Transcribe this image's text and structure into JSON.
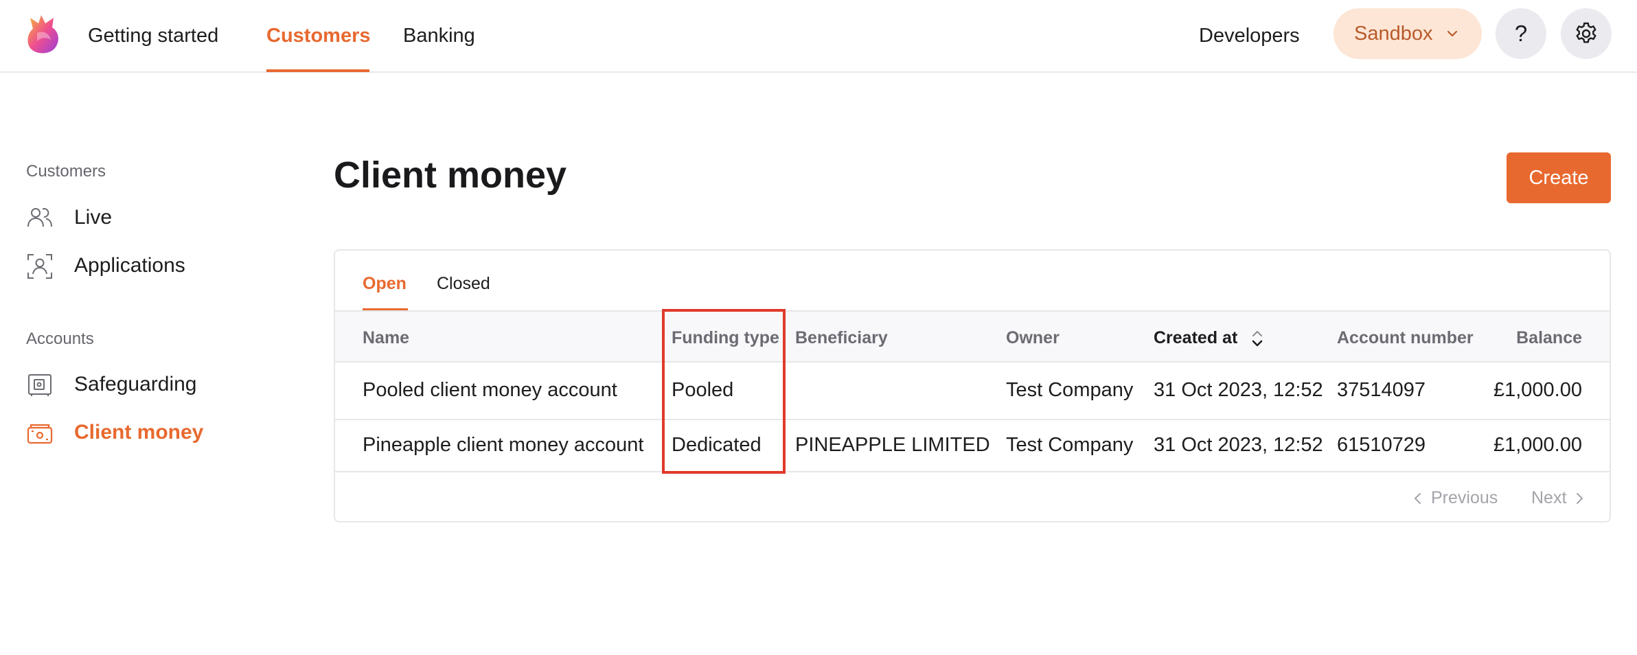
{
  "nav": {
    "items": [
      "Getting started",
      "Customers",
      "Banking"
    ],
    "active": "Customers",
    "developers": "Developers",
    "environment": "Sandbox",
    "help": "?"
  },
  "sidebar": {
    "sections": [
      {
        "heading": "Customers",
        "items": [
          {
            "label": "Live",
            "icon": "people-icon"
          },
          {
            "label": "Applications",
            "icon": "user-scan-icon"
          }
        ]
      },
      {
        "heading": "Accounts",
        "items": [
          {
            "label": "Safeguarding",
            "icon": "safe-icon"
          },
          {
            "label": "Client money",
            "icon": "wallet-icon",
            "active": true
          }
        ]
      }
    ]
  },
  "main": {
    "title": "Client money",
    "create_label": "Create",
    "tabs": [
      "Open",
      "Closed"
    ],
    "active_tab": "Open",
    "columns": [
      "Name",
      "Funding type",
      "Beneficiary",
      "Owner",
      "Created at",
      "Account number",
      "Balance"
    ],
    "sorted_column": "Created at",
    "rows": [
      {
        "name": "Pooled client money account",
        "funding_type": "Pooled",
        "beneficiary": "",
        "owner": "Test Company",
        "created_at": "31 Oct 2023, 12:52",
        "account_number": "37514097",
        "balance": "£1,000.00"
      },
      {
        "name": "Pineapple client money account",
        "funding_type": "Dedicated",
        "beneficiary": "PINEAPPLE LIMITED",
        "owner": "Test Company",
        "created_at": "31 Oct 2023, 12:52",
        "account_number": "61510729",
        "balance": "£1,000.00"
      }
    ],
    "pagination": {
      "previous": "Previous",
      "next": "Next"
    }
  },
  "colors": {
    "accent": "#e8692f",
    "highlight": "#e03a2b",
    "sandbox_bg": "#fde6d6"
  }
}
